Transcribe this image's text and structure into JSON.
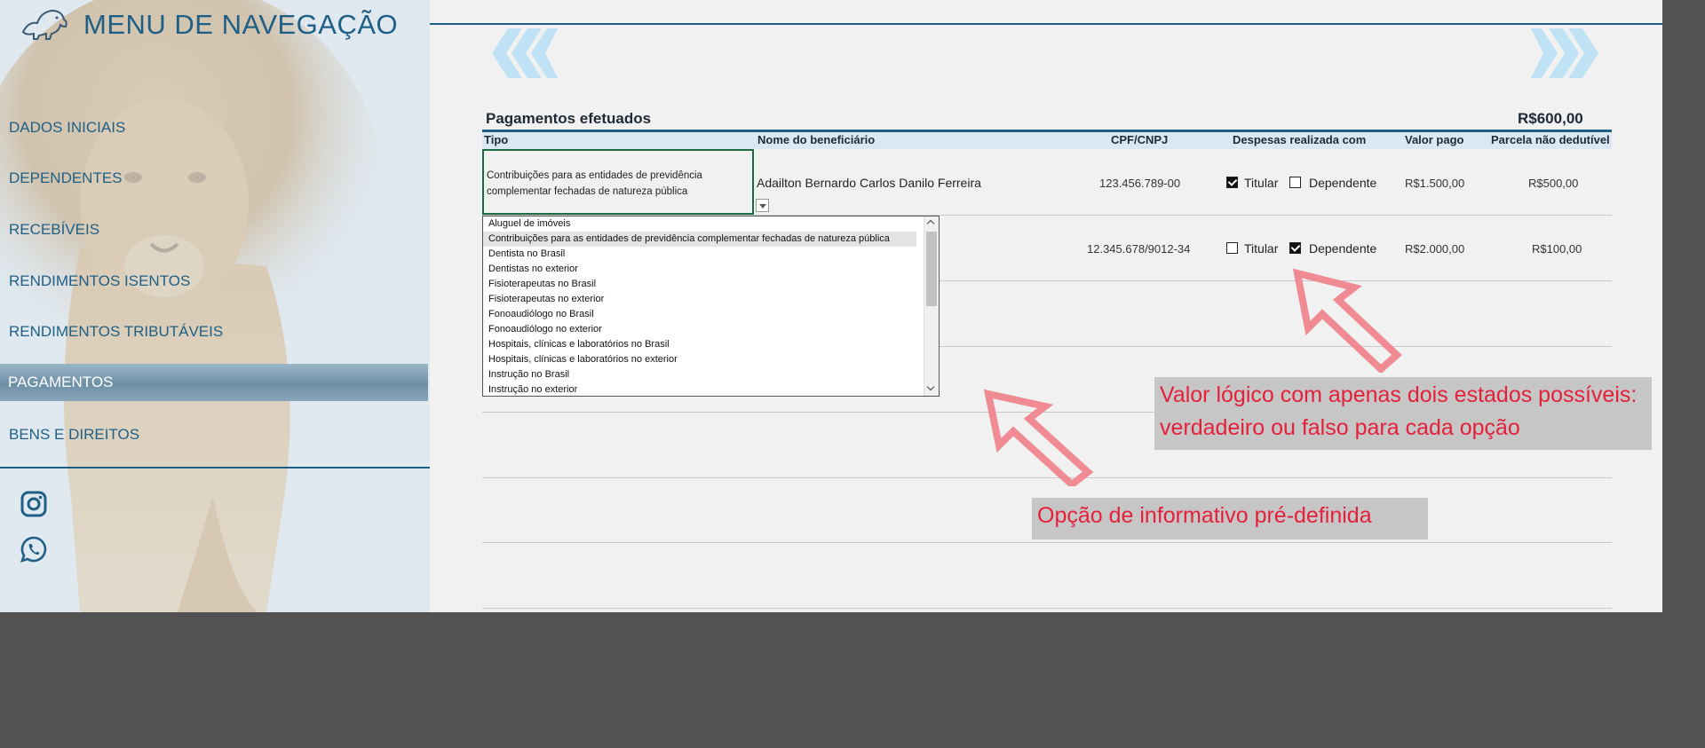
{
  "sidebar": {
    "title": "MENU DE NAVEGAÇÃO",
    "items": [
      {
        "label": "DADOS INICIAIS"
      },
      {
        "label": "DEPENDENTES"
      },
      {
        "label": "RECEBÍVEIS"
      },
      {
        "label": "RENDIMENTOS ISENTOS"
      },
      {
        "label": "RENDIMENTOS TRIBUTÁVEIS"
      },
      {
        "label": "PAGAMENTOS",
        "active": true
      },
      {
        "label": "BENS E DIREITOS"
      }
    ],
    "social": [
      "instagram-icon",
      "whatsapp-icon"
    ]
  },
  "section": {
    "title": "Pagamentos efetuados",
    "total": "R$600,00"
  },
  "table": {
    "headers": {
      "tipo": "Tipo",
      "nome": "Nome do beneficiário",
      "cpf": "CPF/CNPJ",
      "despesas": "Despesas realizada com",
      "valor": "Valor pago",
      "parcela": "Parcela não dedutível"
    },
    "rows": [
      {
        "tipo": "Contribuições para as entidades de previdência complementar fechadas de natureza pública",
        "nome": "Adailton Bernardo Carlos Danilo Ferreira",
        "cpf": "123.456.789-00",
        "titular_label": "Titular",
        "titular": true,
        "dependente_label": "Dependente",
        "dependente": false,
        "valor": "R$1.500,00",
        "parcela": "R$500,00"
      },
      {
        "tipo": "",
        "nome": "",
        "cpf": "12.345.678/9012-34",
        "titular_label": "Titular",
        "titular": false,
        "dependente_label": "Dependente",
        "dependente": true,
        "valor": "R$2.000,00",
        "parcela": "R$100,00"
      }
    ]
  },
  "dropdown": {
    "options": [
      "Aluguel de imóveis",
      "Contribuições para as entidades de previdência complementar fechadas de natureza pública",
      "Dentista no Brasil",
      "Dentistas no exterior",
      "Fisioterapeutas no Brasil",
      "Fisioterapeutas no exterior",
      "Fonoaudiólogo no Brasil",
      "Fonoaudiólogo no exterior",
      "Hospitais, clínicas e laboratórios no Brasil",
      "Hospitais, clínicas e laboratórios no exterior",
      "Instrução no Brasil",
      "Instrução no exterior"
    ],
    "selected_index": 1
  },
  "annotations": {
    "logical": "Valor lógico com apenas dois estados possíveis: verdadeiro ou falso para cada opção",
    "predefined": "Opção de informativo pré-definida"
  },
  "colors": {
    "accent": "#1f5f86",
    "annotation_text": "#e5203a",
    "arrow": "#f08a93",
    "chevron": "#bfe3f5"
  }
}
